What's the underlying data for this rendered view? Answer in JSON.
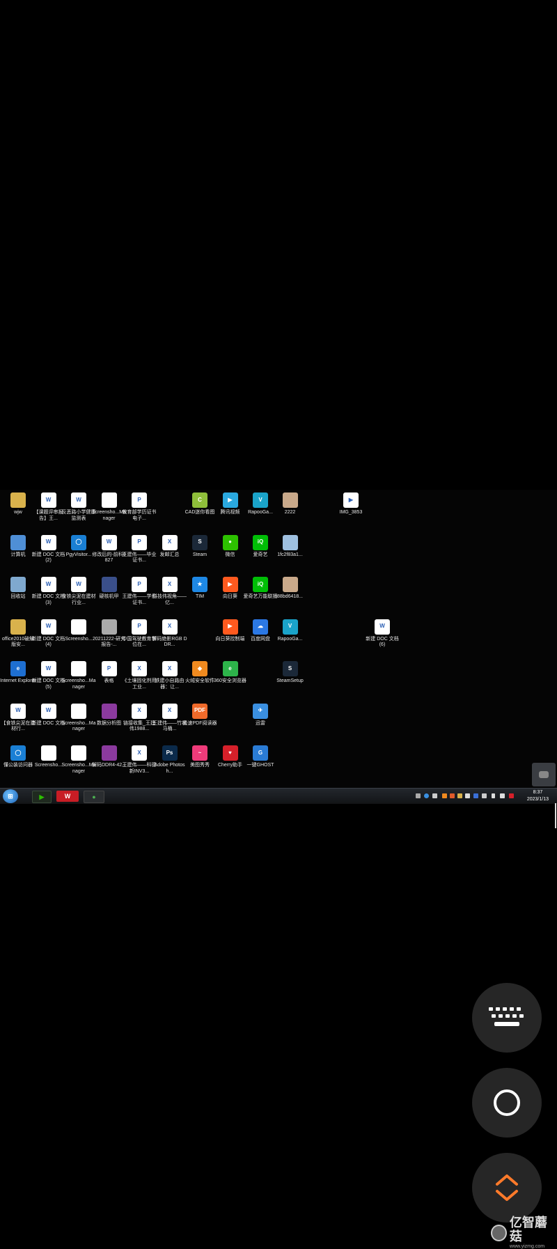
{
  "desktop_icons": [
    {
      "label": "wjw",
      "color": "#d9b24c",
      "glyph": ""
    },
    {
      "label": "【课题评审报告】王...",
      "color": "#ffffff",
      "glyph": "W"
    },
    {
      "label": "反恶路小学健康监测表",
      "color": "#ffffff",
      "glyph": "W"
    },
    {
      "label": "Screensho...Manager",
      "color": "#ffffff",
      "glyph": ""
    },
    {
      "label": "教育部学历证书电子...",
      "color": "#ffffff",
      "glyph": "P"
    },
    {
      "label": "CAD迷你看图",
      "color": "#8fbf3a",
      "glyph": "C"
    },
    {
      "label": "腾讯视频",
      "color": "#2aa9e0",
      "glyph": "▶"
    },
    {
      "label": "RapooGa...",
      "color": "#1aa3c9",
      "glyph": "V"
    },
    {
      "label": "2222",
      "color": "#c9a98a",
      "glyph": ""
    },
    {
      "label": "IMG_3853",
      "color": "#ffffff",
      "glyph": "▶"
    },
    {
      "label": "计算机",
      "color": "#4f8fd6",
      "glyph": ""
    },
    {
      "label": "新建 DOC 文档 (2)",
      "color": "#ffffff",
      "glyph": "W"
    },
    {
      "label": "PgyVisitor...",
      "color": "#1a7fd4",
      "glyph": "◯"
    },
    {
      "label": "修改后的-前科0827",
      "color": "#ffffff",
      "glyph": "W"
    },
    {
      "label": "王建伟——毕业证书...",
      "color": "#ffffff",
      "glyph": "P"
    },
    {
      "label": "发邮汇总",
      "color": "#ffffff",
      "glyph": "X"
    },
    {
      "label": "Steam",
      "color": "#1b2838",
      "glyph": "S"
    },
    {
      "label": "微信",
      "color": "#2dc100",
      "glyph": "●"
    },
    {
      "label": "爱奇艺",
      "color": "#00be06",
      "glyph": "iQ"
    },
    {
      "label": "1fc2f83a1...",
      "color": "#9fc0e0",
      "glyph": ""
    },
    {
      "label": "回收站",
      "color": "#7fa9cf",
      "glyph": ""
    },
    {
      "label": "新建 DOC 文档 (3)",
      "color": "#ffffff",
      "glyph": "W"
    },
    {
      "label": "食铁尖泥在建材行业...",
      "color": "#ffffff",
      "glyph": "W"
    },
    {
      "label": "硬核机甲",
      "color": "#3a4f8a",
      "glyph": ""
    },
    {
      "label": "王建伟——学位证书...",
      "color": "#ffffff",
      "glyph": "P"
    },
    {
      "label": "科技伟视角——亿...",
      "color": "#ffffff",
      "glyph": "X"
    },
    {
      "label": "TIM",
      "color": "#1e88e5",
      "glyph": "★"
    },
    {
      "label": "向日葵",
      "color": "#ff5a1f",
      "glyph": "▶"
    },
    {
      "label": "爱奇艺万能联播",
      "color": "#00be06",
      "glyph": "iQ"
    },
    {
      "label": "88bd6418...",
      "color": "#c9a98a",
      "glyph": ""
    },
    {
      "label": "office2010破解版安...",
      "color": "#d9b24c",
      "glyph": ""
    },
    {
      "label": "新建 DOC 文档 (4)",
      "color": "#ffffff",
      "glyph": "W"
    },
    {
      "label": "Screensho...",
      "color": "#ffffff",
      "glyph": ""
    },
    {
      "label": "20211222-研究报告-...",
      "color": "#aaaaaa",
      "glyph": ""
    },
    {
      "label": "中国驾驶教育学位在...",
      "color": "#ffffff",
      "glyph": "P"
    },
    {
      "label": "解码绝影RGB DDR...",
      "color": "#ffffff",
      "glyph": "X"
    },
    {
      "label": "向日葵控制端",
      "color": "#ff5a1f",
      "glyph": "▶"
    },
    {
      "label": "百度网盘",
      "color": "#2b78e4",
      "glyph": "☁"
    },
    {
      "label": "RapooGa...",
      "color": "#1aa3c9",
      "glyph": "V"
    },
    {
      "label": "新建 DOC 文档 (6)",
      "color": "#ffffff",
      "glyph": "W"
    },
    {
      "label": "Internet Explorer",
      "color": "#1e6fd1",
      "glyph": "e"
    },
    {
      "label": "新建 DOC 文档 (5)",
      "color": "#ffffff",
      "glyph": "W"
    },
    {
      "label": "Screensho...Manager",
      "color": "#ffffff",
      "glyph": ""
    },
    {
      "label": "表格",
      "color": "#ffffff",
      "glyph": "P"
    },
    {
      "label": "《土壤固化剂用工业...",
      "color": "#ffffff",
      "glyph": "X"
    },
    {
      "label": "铁建小自路由器：让...",
      "color": "#ffffff",
      "glyph": "X"
    },
    {
      "label": "火绒安全软件",
      "color": "#f08a1f",
      "glyph": "◆"
    },
    {
      "label": "360安全浏览器",
      "color": "#2db44a",
      "glyph": "e"
    },
    {
      "label": "SteamSetup",
      "color": "#1b2838",
      "glyph": "S"
    },
    {
      "label": "【食铁尖泥在建材行...",
      "color": "#ffffff",
      "glyph": "W"
    },
    {
      "label": "新建 DOC 文档",
      "color": "#ffffff",
      "glyph": "W"
    },
    {
      "label": "Screensho...Manager",
      "color": "#ffffff",
      "glyph": ""
    },
    {
      "label": "数据分析图",
      "color": "#8b3a9e",
      "glyph": ""
    },
    {
      "label": "链接收集_王建伟1988...",
      "color": "#ffffff",
      "glyph": "X"
    },
    {
      "label": "王建伟——竹状马桶...",
      "color": "#ffffff",
      "glyph": "X"
    },
    {
      "label": "极速PDF阅读器",
      "color": "#f06a2a",
      "glyph": "PDF"
    },
    {
      "label": "迅雷",
      "color": "#3a8fe0",
      "glyph": "✈"
    },
    {
      "label": "懂公装访问器",
      "color": "#1a7fd4",
      "glyph": "◯"
    },
    {
      "label": "Screensho...",
      "color": "#ffffff",
      "glyph": ""
    },
    {
      "label": "Screensho...Manager",
      "color": "#ffffff",
      "glyph": ""
    },
    {
      "label": "解码DDR4-42...",
      "color": "#8b3a9e",
      "glyph": ""
    },
    {
      "label": "王建伟——科德新INV3...",
      "color": "#ffffff",
      "glyph": "X"
    },
    {
      "label": "Adobe Photosh...",
      "color": "#0b2a4a",
      "glyph": "Ps"
    },
    {
      "label": "美图秀秀",
      "color": "#ef3b7a",
      "glyph": "~"
    },
    {
      "label": "Cherry助手",
      "color": "#d6202a",
      "glyph": "♥"
    },
    {
      "label": "一键GHOST",
      "color": "#2a7bd4",
      "glyph": "G"
    }
  ],
  "taskbar": {
    "start_label": "Start",
    "apps": [
      {
        "name": "iqiyi",
        "color": "#2dc100",
        "glyph": "▶"
      },
      {
        "name": "wps",
        "color": "#d6202a",
        "glyph": "W"
      },
      {
        "name": "360",
        "color": "#4caf50",
        "glyph": "●"
      }
    ],
    "clock_time": "8:37",
    "clock_date": "2023/1/13"
  },
  "overlay_buttons": {
    "keyboard_icon": "keyboard-icon",
    "home_icon": "circle-icon",
    "nav_icon": "chevron-up-down-icon"
  },
  "watermark": {
    "text": "亿智蘑菇",
    "url": "www.yizmg.com"
  }
}
